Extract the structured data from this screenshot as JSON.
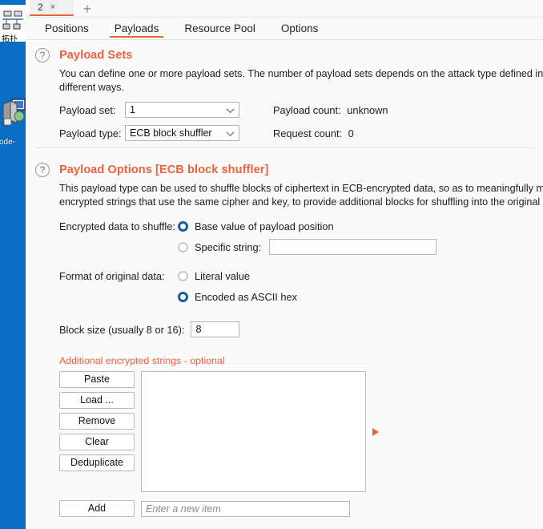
{
  "desktop": {
    "icon1_label": "拓扑",
    "icon2_label": "ode-"
  },
  "window": {
    "attack_tabs": [
      {
        "label": "2",
        "close": "×"
      }
    ],
    "new_tab_label": "+",
    "subtabs": [
      {
        "label": "Positions",
        "active": false
      },
      {
        "label": "Payloads",
        "active": true
      },
      {
        "label": "Resource Pool",
        "active": false
      },
      {
        "label": "Options",
        "active": false
      }
    ]
  },
  "payload_sets": {
    "help_icon": "?",
    "title": "Payload Sets",
    "description_line1": "You can define one or more payload sets. The number of payload sets depends on the attack type defined in the Po",
    "description_line2": "different ways.",
    "payload_set_label": "Payload set:",
    "payload_set_value": "1",
    "payload_type_label": "Payload type:",
    "payload_type_value": "ECB block shuffler",
    "payload_count_label": "Payload count:",
    "payload_count_value": "unknown",
    "request_count_label": "Request count:",
    "request_count_value": "0"
  },
  "payload_options": {
    "help_icon": "?",
    "title": "Payload Options [ECB block shuffler]",
    "description_line1": "This payload type can be used to shuffle blocks of ciphertext in ECB-encrypted data, so as to meaningfully modify t",
    "description_line2": "encrypted strings that use the same cipher and key, to provide additional blocks for shuffling into the original data.",
    "encrypted_data_label": "Encrypted data to shuffle:",
    "option_base_value": "Base value of payload position",
    "option_base_value_selected": true,
    "option_specific_string": "Specific string:",
    "option_specific_string_selected": false,
    "specific_string_value": "",
    "format_label": "Format of original data:",
    "option_literal": "Literal value",
    "option_literal_selected": false,
    "option_hex": "Encoded as ASCII hex",
    "option_hex_selected": true,
    "block_size_label": "Block size (usually 8 or 16):",
    "block_size_value": "8"
  },
  "additional_strings": {
    "title": "Additional encrypted strings - optional",
    "buttons": [
      {
        "label": "Paste"
      },
      {
        "label": "Load ..."
      },
      {
        "label": "Remove"
      },
      {
        "label": "Clear"
      },
      {
        "label": "Deduplicate"
      }
    ],
    "list_items": [],
    "add_button_label": "Add",
    "add_input_placeholder": "Enter a new item",
    "add_input_value": ""
  },
  "colors": {
    "accent_orange": "#f0603c",
    "radio_selected_blue": "#1a5c9e",
    "desktop_blue": "#0a6ec4",
    "window_bg": "#fafafa"
  }
}
